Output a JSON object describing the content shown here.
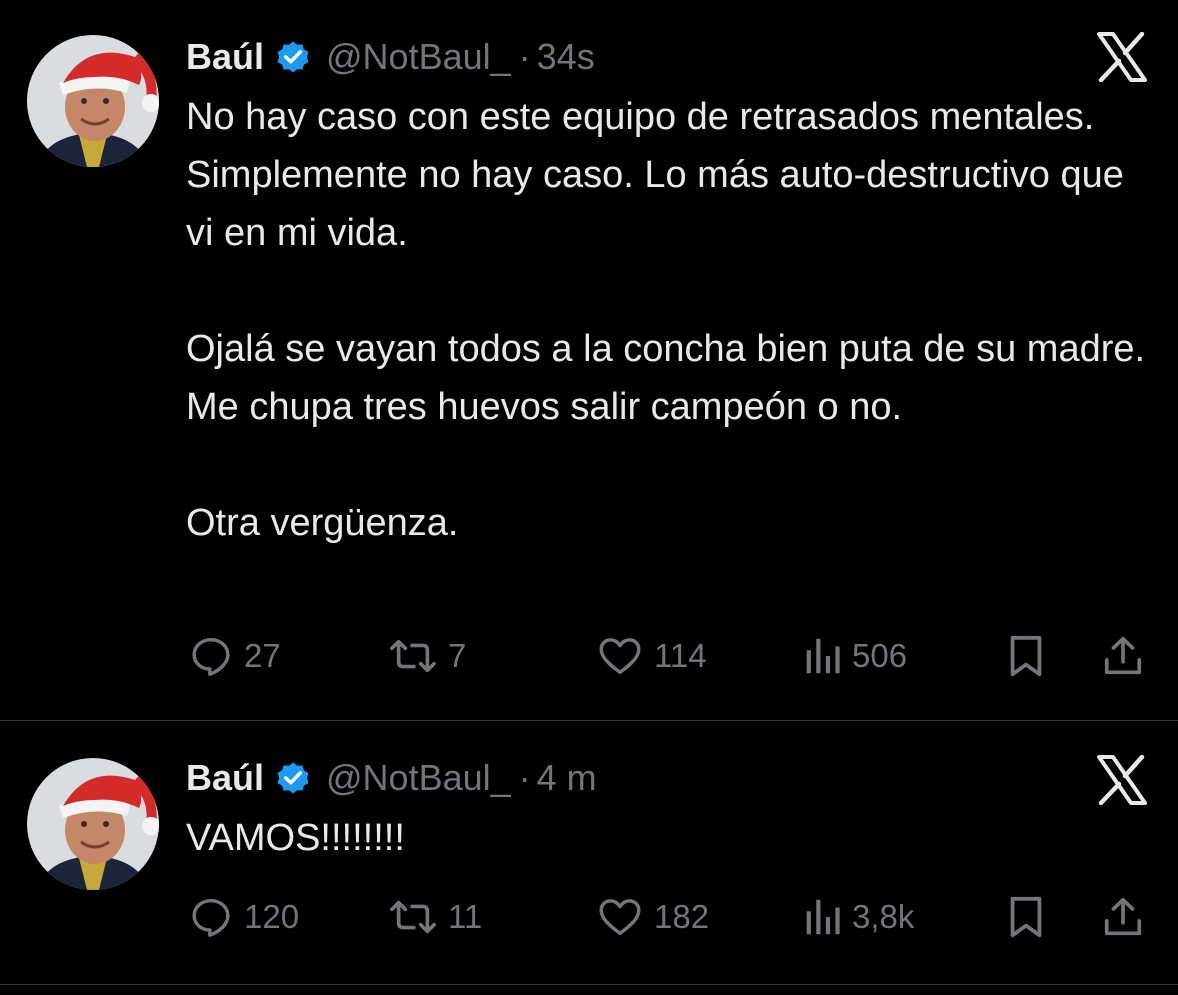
{
  "tweets": [
    {
      "author_name": "Baúl",
      "handle": "@NotBaul_",
      "separator": "·",
      "time": "34s",
      "paragraphs": [
        "No hay caso con este equipo de retrasados mentales. Simplemente no hay caso. Lo más auto-destructivo que vi en mi vida.",
        "Ojalá se vayan todos a la concha bien puta de su madre. Me chupa tres huevos salir campeón o no.",
        "Otra vergüenza."
      ],
      "replies": "27",
      "retweets": "7",
      "likes": "114",
      "views": "506"
    },
    {
      "author_name": "Baúl",
      "handle": "@NotBaul_",
      "separator": "·",
      "time": "4 m",
      "paragraphs": [
        "VAMOS!!!!!!!!"
      ],
      "replies": "120",
      "retweets": "11",
      "likes": "182",
      "views": "3,8k"
    }
  ],
  "icons": {
    "verified": "verified-badge-icon",
    "logo": "x-logo-icon",
    "reply": "reply-icon",
    "retweet": "retweet-icon",
    "like": "heart-icon",
    "views": "views-chart-icon",
    "bookmark": "bookmark-icon",
    "share": "share-icon"
  },
  "colors": {
    "background": "#000000",
    "text_primary": "#e7e9ea",
    "text_secondary": "#71767b",
    "verified_blue": "#1d9bf0",
    "divider": "#2f3336"
  }
}
